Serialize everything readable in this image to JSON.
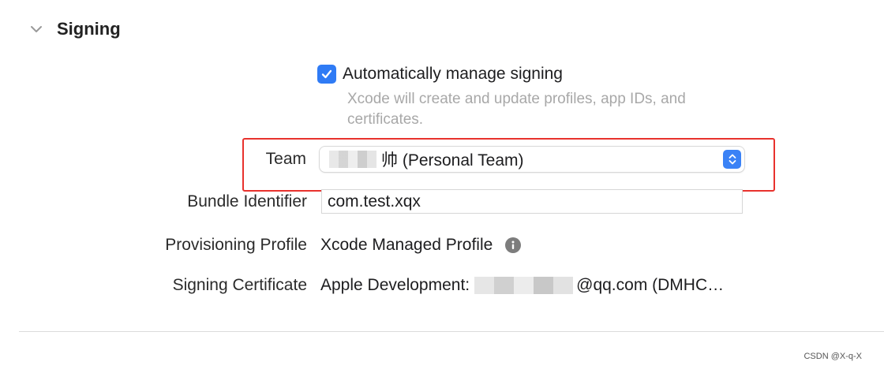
{
  "section": {
    "title": "Signing",
    "chevron_icon": "chevron-down-icon"
  },
  "auto_signing": {
    "checked": true,
    "label": "Automatically manage signing",
    "description": "Xcode will create and update profiles, app IDs, and certificates."
  },
  "team": {
    "label": "Team",
    "value": "帅 (Personal Team)",
    "control_icon": "up-down-chevron-icon"
  },
  "bundle": {
    "label": "Bundle Identifier",
    "value": "com.test.xqx"
  },
  "profile": {
    "label": "Provisioning Profile",
    "value": "Xcode Managed Profile",
    "icon": "info-icon"
  },
  "certificate": {
    "label": "Signing Certificate",
    "prefix": "Apple Development:",
    "suffix": "@qq.com (DMHC…"
  },
  "watermark": "CSDN @X-q-X",
  "colors": {
    "accent": "#2f7bf5",
    "highlight_border": "#e8322d",
    "secondary_text": "#a8a8a8"
  }
}
